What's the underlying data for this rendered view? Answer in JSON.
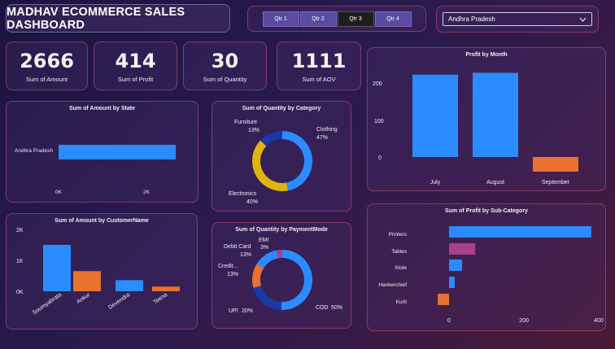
{
  "header": {
    "title": "MADHAV ECOMMERCE SALES DASHBOARD"
  },
  "slicer": {
    "quarters": [
      {
        "label": "Qtr 1",
        "active": false
      },
      {
        "label": "Qtr 2",
        "active": false
      },
      {
        "label": "Qtr 3",
        "active": true
      },
      {
        "label": "Qtr 4",
        "active": false
      }
    ],
    "state_selected": "Andhra Pradesh"
  },
  "kpis": [
    {
      "value": "2666",
      "label": "Sum of Amount"
    },
    {
      "value": "414",
      "label": "Sum of Profit"
    },
    {
      "value": "30",
      "label": "Sum of Quantity"
    },
    {
      "value": "1111",
      "label": "Sum of AOV"
    }
  ],
  "colors": {
    "blue": "#2b8cff",
    "orange": "#e8722e",
    "navy": "#1a3aa8",
    "yellow": "#e0b40e",
    "purple": "#a8408a"
  },
  "chart_data": [
    {
      "type": "bar",
      "title": "Sum of Amount by State",
      "orientation": "horizontal",
      "categories": [
        "Andhra Pradesh"
      ],
      "values": [
        2666
      ],
      "xticks": [
        "0K",
        "2K"
      ],
      "xlim": [
        0,
        3000
      ]
    },
    {
      "type": "pie",
      "title": "Sum of Quantity by Category",
      "donut": true,
      "slices": [
        {
          "label": "Clothing",
          "pct": "47%",
          "value": 47,
          "color": "#2b8cff"
        },
        {
          "label": "Electronics",
          "pct": "40%",
          "value": 40,
          "color": "#e0b40e"
        },
        {
          "label": "Furniture",
          "pct": "13%",
          "value": 13,
          "color": "#1a3aa8"
        }
      ]
    },
    {
      "type": "bar",
      "title": "Profit by Month",
      "categories": [
        "July",
        "August",
        "September"
      ],
      "values": [
        225,
        230,
        -40
      ],
      "yticks": [
        "0",
        "100",
        "200"
      ],
      "ylim": [
        -50,
        250
      ]
    },
    {
      "type": "bar",
      "title": "Sum of Amount by CustomerName",
      "categories": [
        "Soumyabrata",
        "Ankur",
        "Devendra",
        "Teena"
      ],
      "values": [
        1500,
        650,
        360,
        150
      ],
      "yticks": [
        "0K",
        "1K",
        "2K"
      ],
      "ylim": [
        0,
        2000
      ]
    },
    {
      "type": "pie",
      "title": "Sum of Quantity by PaymentMode",
      "donut": true,
      "slices": [
        {
          "label": "COD",
          "pct": "50%",
          "value": 50,
          "color": "#2b8cff"
        },
        {
          "label": "UPI",
          "pct": "20%",
          "value": 20,
          "color": "#1a3aa8"
        },
        {
          "label": "Credit...",
          "pct": "13%",
          "value": 13,
          "color": "#e8722e"
        },
        {
          "label": "Debit Card",
          "pct": "13%",
          "value": 13,
          "color": "#2b8cff"
        },
        {
          "label": "EMI",
          "pct": "3%",
          "value": 3,
          "color": "#a8408a"
        }
      ]
    },
    {
      "type": "bar",
      "title": "Sum of Profit by Sub-Category",
      "orientation": "horizontal",
      "categories": [
        "Printers",
        "Tables",
        "Stole",
        "Hankerchief",
        "Kurti"
      ],
      "values": [
        380,
        70,
        35,
        15,
        -30
      ],
      "xticks": [
        "0",
        "200",
        "400"
      ],
      "xlim": [
        -40,
        400
      ]
    }
  ]
}
